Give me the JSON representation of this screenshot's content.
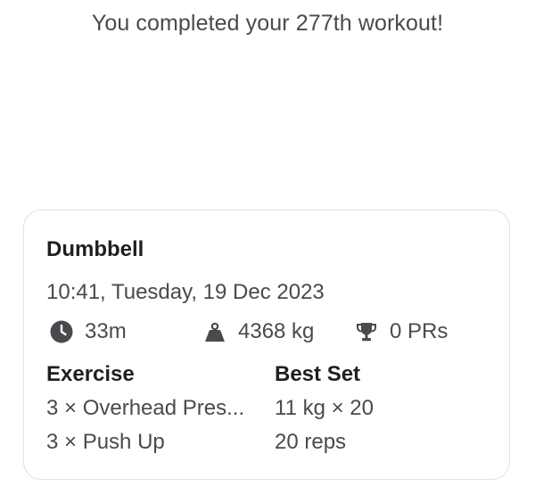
{
  "headline": "You completed your 277th workout!",
  "workout": {
    "title": "Dumbbell",
    "datetime": "10:41, Tuesday, 19 Dec 2023",
    "stats": {
      "duration": "33m",
      "volume": "4368 kg",
      "prs": "0 PRs"
    },
    "icons": {
      "duration": "clock-icon",
      "volume": "weight-icon",
      "prs": "trophy-icon"
    },
    "columns": {
      "exercise": "Exercise",
      "best_set": "Best Set"
    },
    "rows": [
      {
        "exercise": "3 × Overhead Pres...",
        "best_set": "11 kg × 20"
      },
      {
        "exercise": "3 × Push Up",
        "best_set": "20 reps"
      }
    ]
  },
  "colors": {
    "icon": "#4a4a4e",
    "text": "#4a4a4e",
    "heading": "#1f1f22",
    "border": "#e1e1e4"
  }
}
